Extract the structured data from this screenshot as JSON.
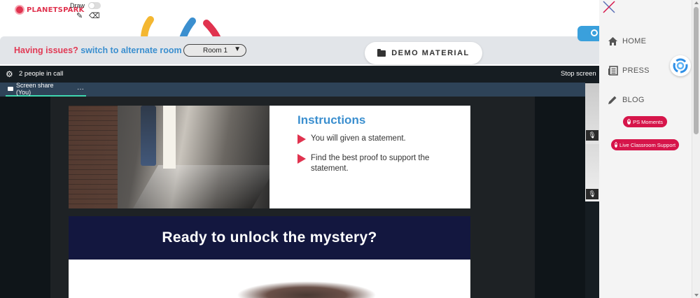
{
  "header": {
    "logo_text": "PLANETSPARK",
    "draw_label": "Draw",
    "icons": [
      "pencil-icon",
      "eraser-icon"
    ]
  },
  "issues_bar": {
    "text": "Having issues?",
    "link": "switch to alternate room",
    "room_value": "Room 1"
  },
  "demo_material": {
    "label": "DEMO MATERIAL"
  },
  "call": {
    "people_count": "2 people in call",
    "stop_label": "Stop screen",
    "tab_label": "Screen share (You)",
    "tab_more": "···"
  },
  "slide1": {
    "title": "Instructions",
    "bullets": [
      "You will given a statement.",
      "Find the best proof to support the statement."
    ]
  },
  "slide2": {
    "heading": "Ready to unlock the mystery?"
  },
  "sidebar": {
    "nav": [
      {
        "label": "HOME",
        "icon": "home-icon"
      },
      {
        "label": "PRESS",
        "icon": "newspaper-icon"
      },
      {
        "label": "BLOG",
        "icon": "pencil-icon"
      }
    ],
    "pills": [
      "PS Moments",
      "Live Classroom Support"
    ]
  },
  "colors": {
    "brand_red": "#e0334f",
    "link_blue": "#3b8fcf",
    "call_bg": "#161d22",
    "tab_bar": "#2e4358",
    "tab_underline": "#3fd7b0",
    "slide_band": "#13173f",
    "pill_red": "#d6154a"
  }
}
